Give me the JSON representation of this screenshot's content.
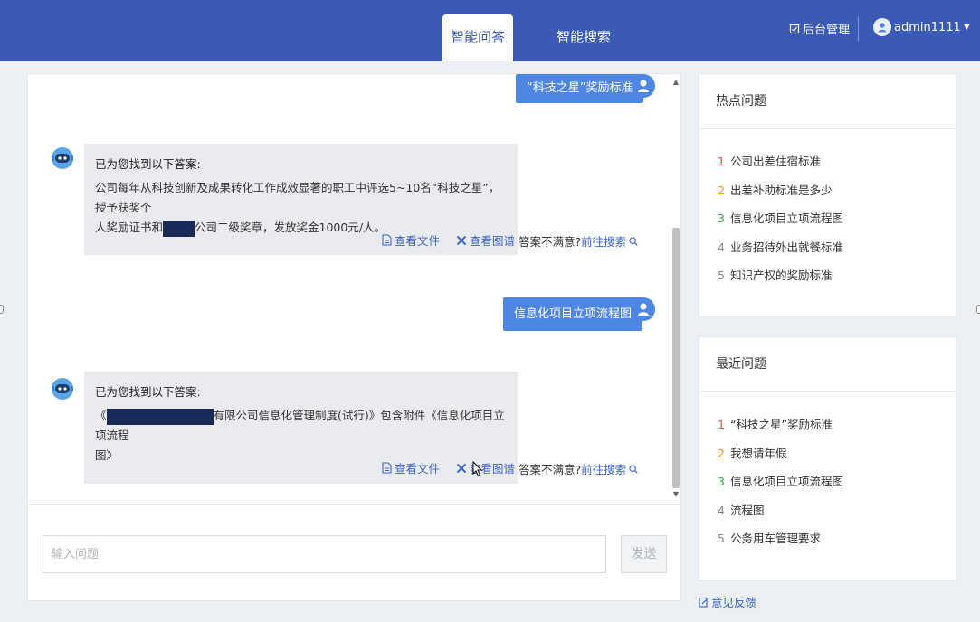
{
  "header": {
    "tabs": [
      {
        "label": "智能问答",
        "active": true
      },
      {
        "label": "智能搜索",
        "active": false
      }
    ],
    "admin_label": "后台管理",
    "username": "admin1111"
  },
  "chat": {
    "messages": [
      {
        "role": "user",
        "text": "“科技之星”奖励标准"
      },
      {
        "role": "bot",
        "title": "已为您找到以下答案:",
        "line1": "公司每年从科技创新及成果转化工作成效显著的职工中评选5~10名“科技之星”，授予获奖个",
        "line2a": "人奖励证书和",
        "line2b": "公司二级奖章，发放奖金1000元/人。",
        "view_file": "查看文件",
        "view_graph": "查看图谱",
        "unsatisfied": "答案不满意?",
        "go_search": "前往搜索"
      },
      {
        "role": "user",
        "text": "信息化项目立项流程图"
      },
      {
        "role": "bot",
        "title": "已为您找到以下答案:",
        "line1a": "《",
        "line1b": "有限公司信息化管理制度(试行)》包含附件《信息化项目立项流程",
        "line2": "图》",
        "view_file": "查看文件",
        "view_graph": "查看图谱",
        "unsatisfied": "答案不满意?",
        "go_search": "前往搜索"
      }
    ],
    "input_placeholder": "输入问题",
    "send_label": "发送"
  },
  "hot": {
    "title": "热点问题",
    "items": [
      {
        "num": "1",
        "text": "公司出差住宿标准"
      },
      {
        "num": "2",
        "text": "出差补助标准是多少"
      },
      {
        "num": "3",
        "text": "信息化项目立项流程图"
      },
      {
        "num": "4",
        "text": "业务招待外出就餐标准"
      },
      {
        "num": "5",
        "text": "知识产权的奖励标准"
      }
    ]
  },
  "recent": {
    "title": "最近问题",
    "items": [
      {
        "num": "1",
        "text": "“科技之星”奖励标准"
      },
      {
        "num": "2",
        "text": "我想请年假"
      },
      {
        "num": "3",
        "text": "信息化项目立项流程图"
      },
      {
        "num": "4",
        "text": "流程图"
      },
      {
        "num": "5",
        "text": "公务用车管理要求"
      }
    ]
  },
  "feedback_label": "意见反馈",
  "colors": {
    "header_bg": "#3a5bb5",
    "user_bubble": "#4e86e4",
    "link": "#3a64c7",
    "bot_bubble": "#eaebee"
  }
}
